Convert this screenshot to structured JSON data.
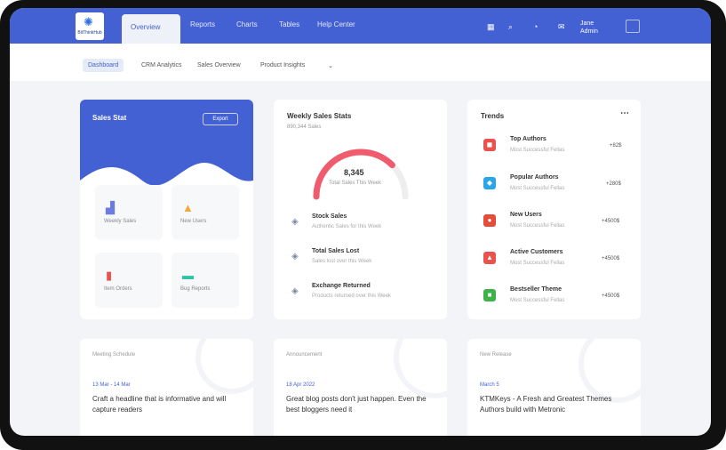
{
  "brand": {
    "name": "BitThinkHub"
  },
  "nav": {
    "items": [
      "Overview",
      "Reports",
      "Charts",
      "Tables",
      "Help Center"
    ]
  },
  "user": {
    "line1": "Jane",
    "line2": "Admin"
  },
  "subnav": {
    "items": [
      "Dashboard",
      "CRM Analytics",
      "Sales Overview",
      "Product Insights"
    ]
  },
  "sales_stat": {
    "title": "Sales Stat",
    "button": "Export",
    "tiles": [
      "Weekly Sales",
      "New Users",
      "Item Orders",
      "Bug Reports"
    ]
  },
  "weekly_sales": {
    "title": "Weekly Sales Stats",
    "subtitle": "890,344 Sales",
    "gauge_value": "8,345",
    "gauge_caption": "Total Sales This Week",
    "progress": 0.75,
    "rows": [
      {
        "title": "Stock Sales",
        "sub": "Authentic Sales for this Week"
      },
      {
        "title": "Total Sales Lost",
        "sub": "Sales lost over this Week"
      },
      {
        "title": "Exchange Returned",
        "sub": "Products returned over this Week"
      }
    ]
  },
  "trends": {
    "title": "Trends",
    "items": [
      {
        "title": "Top Authors",
        "sub": "Most Successful Fellas",
        "value": "+82$",
        "color": "#e8534e",
        "icon": "pdf-icon"
      },
      {
        "title": "Popular Authors",
        "sub": "Most Successful Fellas",
        "value": "+280$",
        "color": "#2aa5e8",
        "icon": "twitter-icon"
      },
      {
        "title": "New Users",
        "sub": "Most Successful Fellas",
        "value": "+4500$",
        "color": "#e44d3a",
        "icon": "google-icon"
      },
      {
        "title": "Active Customers",
        "sub": "Most Successful Fellas",
        "value": "+4500$",
        "color": "#e8534e",
        "icon": "chart-icon"
      },
      {
        "title": "Bestseller Theme",
        "sub": "Most Successful Fellas",
        "value": "+4500$",
        "color": "#3cb34a",
        "icon": "excel-icon"
      }
    ]
  },
  "bottom": [
    {
      "label": "Meeting Schedule",
      "date": "13 Mar - 14 Mar",
      "headline": "Craft a headline that is informative and will capture readers"
    },
    {
      "label": "Announcement",
      "date": "18 Apr 2022",
      "headline": "Great blog posts don't just happen. Even the best bloggers need it"
    },
    {
      "label": "New Release",
      "date": "March 5",
      "headline": "KTMKeys - A Fresh and Greatest Themes Authors build with Metronic"
    }
  ]
}
